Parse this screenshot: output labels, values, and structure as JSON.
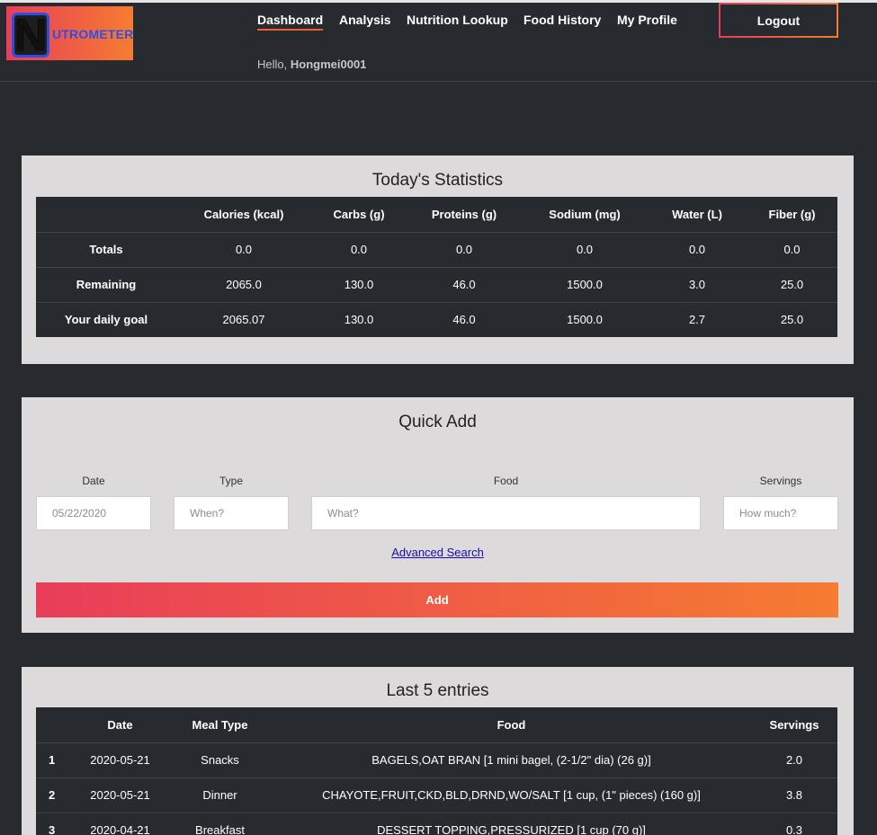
{
  "logo": {
    "letter": "N",
    "text": "UTROMETER"
  },
  "nav": {
    "items": [
      {
        "label": "Dashboard"
      },
      {
        "label": "Analysis"
      },
      {
        "label": "Nutrition Lookup"
      },
      {
        "label": "Food History"
      },
      {
        "label": "My Profile"
      }
    ],
    "logout_label": "Logout"
  },
  "greeting": {
    "prefix": "Hello,",
    "username": "Hongmei0001"
  },
  "stats": {
    "title": "Today's Statistics",
    "headers": [
      "",
      "Calories (kcal)",
      "Carbs (g)",
      "Proteins (g)",
      "Sodium (mg)",
      "Water (L)",
      "Fiber (g)"
    ],
    "rows": [
      [
        "Totals",
        "0.0",
        "0.0",
        "0.0",
        "0.0",
        "0.0",
        "0.0"
      ],
      [
        "Remaining",
        "2065.0",
        "130.0",
        "46.0",
        "1500.0",
        "3.0",
        "25.0"
      ],
      [
        "Your daily goal",
        "2065.07",
        "130.0",
        "46.0",
        "1500.0",
        "2.7",
        "25.0"
      ]
    ]
  },
  "quick_add": {
    "title": "Quick Add",
    "date_label": "Date",
    "type_label": "Type",
    "food_label": "Food",
    "servings_label": "Servings",
    "date_value": "05/22/2020",
    "type_placeholder": "When?",
    "food_placeholder": "What?",
    "servings_placeholder": "How much?",
    "advanced_link": "Advanced Search",
    "add_label": "Add"
  },
  "entries": {
    "title": "Last 5 entries",
    "headers": [
      "",
      "Date",
      "Meal Type",
      "Food",
      "Servings"
    ],
    "rows": [
      [
        "1",
        "2020-05-21",
        "Snacks",
        "BAGELS,OAT BRAN [1 mini bagel, (2-1/2\" dia) (26 g)]",
        "2.0"
      ],
      [
        "2",
        "2020-05-21",
        "Dinner",
        "CHAYOTE,FRUIT,CKD,BLD,DRND,WO/SALT [1 cup, (1\" pieces) (160 g)]",
        "3.8"
      ],
      [
        "3",
        "2020-04-21",
        "Breakfast",
        "DESSERT TOPPING,PRESSURIZED [1 cup (70 g)]",
        "0.3"
      ]
    ]
  }
}
